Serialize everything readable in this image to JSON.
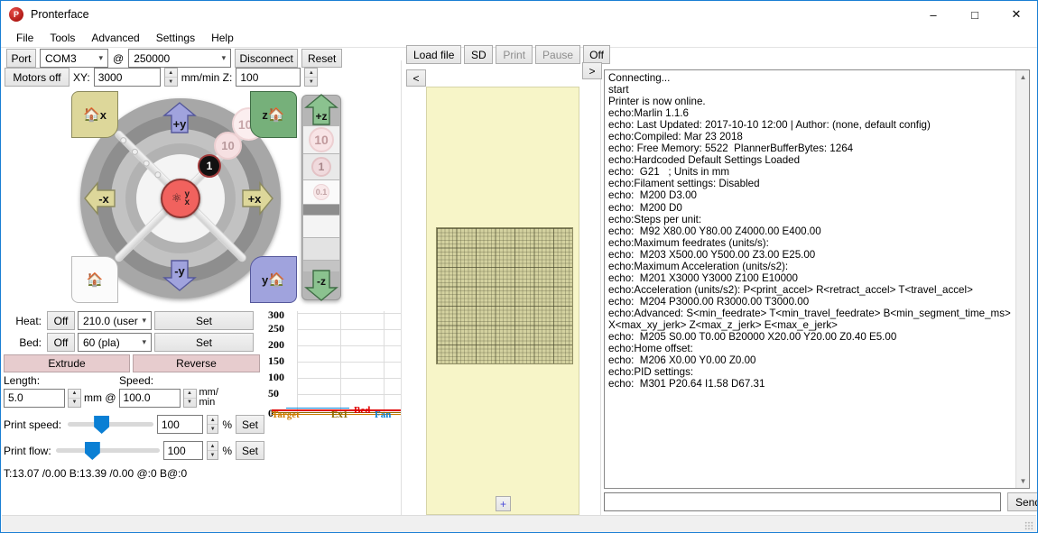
{
  "window": {
    "title": "Pronterface",
    "icon": "pronterface-logo",
    "minimize": "–",
    "maximize": "□",
    "close": "✕"
  },
  "menu": {
    "items": [
      "File",
      "Tools",
      "Advanced",
      "Settings",
      "Help"
    ]
  },
  "connection": {
    "port_button": "Port",
    "port_value": "COM3",
    "at_symbol": "@",
    "baud_value": "250000",
    "disconnect": "Disconnect",
    "reset": "Reset"
  },
  "motion": {
    "motors_off": "Motors off",
    "xy_label": "XY:",
    "xy_value": "3000",
    "units_label": "mm/min Z:",
    "z_value": "100"
  },
  "jog": {
    "plus_y": "+y",
    "minus_y": "-y",
    "plus_x": "+x",
    "minus_x": "-x",
    "home_x": "x",
    "home_z": "z",
    "home_y": "y",
    "home_all": "",
    "center_label_top": "y",
    "center_label_bottom": "x",
    "steps": [
      "100",
      "10",
      "1",
      "0.1"
    ],
    "selected_step": "1"
  },
  "zaxis": {
    "plus_z": "+z",
    "minus_z": "-z",
    "steps": [
      "10",
      "1",
      "0.1"
    ]
  },
  "heat": {
    "heat_label": "Heat:",
    "heat_off": "Off",
    "heat_value": "210.0 (user",
    "heat_set": "Set",
    "bed_label": "Bed:",
    "bed_off": "Off",
    "bed_value": "60 (pla)",
    "bed_set": "Set"
  },
  "extrude": {
    "extrude": "Extrude",
    "reverse": "Reverse",
    "length_label": "Length:",
    "length_value": "5.0",
    "mm_at": "mm @",
    "speed_label": "Speed:",
    "speed_value": "100.0",
    "speed_units_1": "mm/",
    "speed_units_2": "min"
  },
  "sliders": {
    "print_speed_label": "Print speed:",
    "print_speed_value": "100",
    "print_speed_percent": "%",
    "print_speed_set": "Set",
    "print_flow_label": "Print flow:",
    "print_flow_value": "100",
    "print_flow_percent": "%",
    "print_flow_set": "Set"
  },
  "status": {
    "temps": "T:13.07 /0.00 B:13.39 /0.00 @:0 B@:0"
  },
  "print_toolbar": {
    "load_file": "Load file",
    "sd": "SD",
    "print": "Print",
    "pause": "Pause",
    "off": "Off",
    "prev": "<",
    "next": ">",
    "add": "+"
  },
  "console": {
    "lines": "Connecting...\nstart\nPrinter is now online.\necho:Marlin 1.1.6\necho: Last Updated: 2017-10-10 12:00 | Author: (none, default config)\necho:Compiled: Mar 23 2018\necho: Free Memory: 5522  PlannerBufferBytes: 1264\necho:Hardcoded Default Settings Loaded\necho:  G21   ; Units in mm\necho:Filament settings: Disabled\necho:  M200 D3.00\necho:  M200 D0\necho:Steps per unit:\necho:  M92 X80.00 Y80.00 Z4000.00 E400.00\necho:Maximum feedrates (units/s):\necho:  M203 X500.00 Y500.00 Z3.00 E25.00\necho:Maximum Acceleration (units/s2):\necho:  M201 X3000 Y3000 Z100 E10000\necho:Acceleration (units/s2): P<print_accel> R<retract_accel> T<travel_accel>\necho:  M204 P3000.00 R3000.00 T3000.00\necho:Advanced: S<min_feedrate> T<min_travel_feedrate> B<min_segment_time_ms>\nX<max_xy_jerk> Z<max_z_jerk> E<max_e_jerk>\necho:  M205 S0.00 T0.00 B20000 X20.00 Y20.00 Z0.40 E5.00\necho:Home offset:\necho:  M206 X0.00 Y0.00 Z0.00\necho:PID settings:\necho:  M301 P20.64 I1.58 D67.31",
    "send_value": "",
    "send_button": "Send"
  },
  "chart_data": {
    "type": "line",
    "title": "",
    "xlabel": "",
    "ylabel": "",
    "ylim": [
      0,
      300
    ],
    "yticks": [
      300,
      250,
      200,
      150,
      100,
      50,
      0
    ],
    "grid": true,
    "legend_position": "bottom",
    "series": [
      {
        "name": "Target",
        "color": "#cc7a00",
        "values": [
          0,
          0,
          0,
          0,
          0
        ]
      },
      {
        "name": "Ex1",
        "color": "#8a6a00",
        "values": [
          13,
          13,
          13,
          13,
          13
        ]
      },
      {
        "name": "Bed",
        "color": "#e00000",
        "values": [
          13,
          13,
          13,
          13,
          13
        ]
      },
      {
        "name": "Fan",
        "color": "#0a7fd4",
        "values": [
          0,
          0,
          0,
          0,
          0
        ]
      }
    ]
  },
  "colors": {
    "accent": "#1a7fd4",
    "home_x": "#ddd79a",
    "home_z": "#76b07a",
    "home_y": "#a0a3dd",
    "jog_center": "#f1625e",
    "extrude_button": "#e7ccce",
    "viewport_bg": "#f7f5c8",
    "plate": "#d4d2a0"
  }
}
